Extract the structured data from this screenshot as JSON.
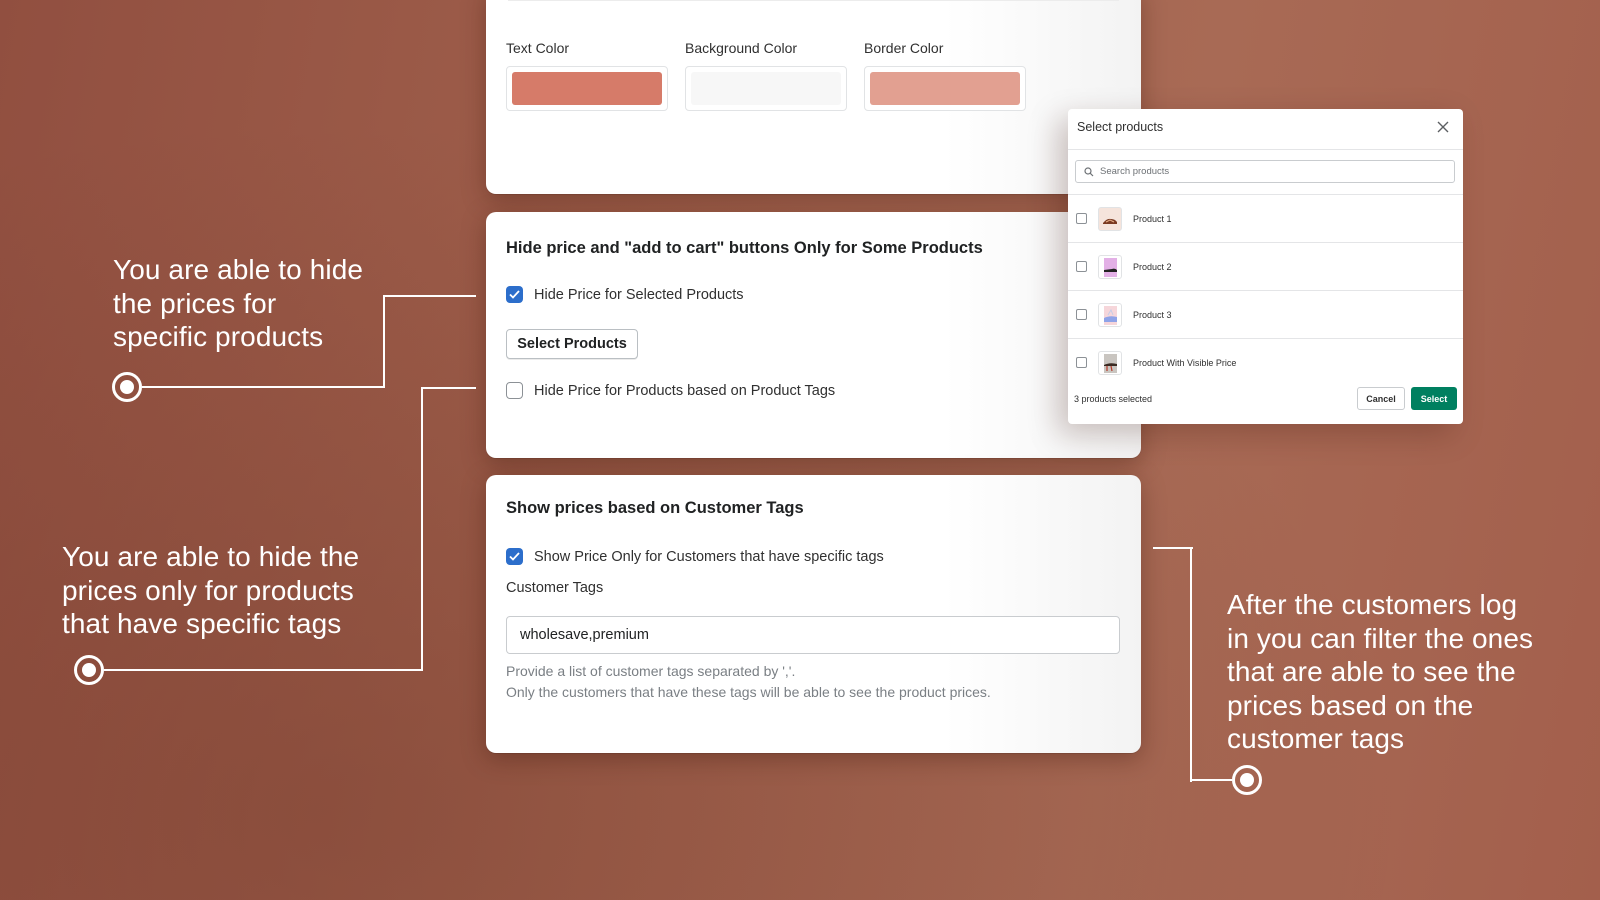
{
  "appearance": {
    "labels": [
      "Text Color",
      "Background Color",
      "Border Color"
    ],
    "colors": {
      "text_color": "#d67b69",
      "background_color": "#f7f7f7",
      "border_color": "#e2a091"
    }
  },
  "hide_products_section": {
    "title": "Hide price and \"add to cart\" buttons Only for Some Products",
    "hide_selected_checkbox": {
      "label": "Hide Price for Selected Products",
      "checked": true
    },
    "select_products_button": "Select Products",
    "hide_by_tags_checkbox": {
      "label": "Hide Price for Products based on Product Tags",
      "checked": false
    }
  },
  "customer_tags_section": {
    "title": "Show prices based on Customer Tags",
    "show_price_checkbox": {
      "label": "Show Price Only for Customers that have specific tags",
      "checked": true
    },
    "field_label": "Customer Tags",
    "field_value": "wholesave,premium",
    "help_line_1": "Provide a list of customer tags separated by ','.",
    "help_line_2": "Only the customers that have these tags will be able to see the product prices."
  },
  "select_products_modal": {
    "title": "Select products",
    "search_placeholder": "Search products",
    "products": [
      {
        "name": "Product 1",
        "checked": false
      },
      {
        "name": "Product 2",
        "checked": false
      },
      {
        "name": "Product 3",
        "checked": false
      },
      {
        "name": "Product With Visible Price",
        "checked": false
      }
    ],
    "selected_count_text": "3 products selected",
    "cancel_label": "Cancel",
    "select_label": "Select"
  },
  "callouts": {
    "specific_products": [
      "You are able to hide",
      "the prices for",
      "specific products"
    ],
    "product_tags": [
      "You are able to hide the",
      "prices only for products",
      "that have specific tags"
    ],
    "customer_tags": [
      "After the customers log",
      "in you can filter the ones",
      "that are able to see the",
      "prices based on the",
      "customer tags"
    ]
  },
  "theme": {
    "primary_checkbox": "#2c6ecb",
    "primary_button": "#008060",
    "background": "#a0604c"
  }
}
